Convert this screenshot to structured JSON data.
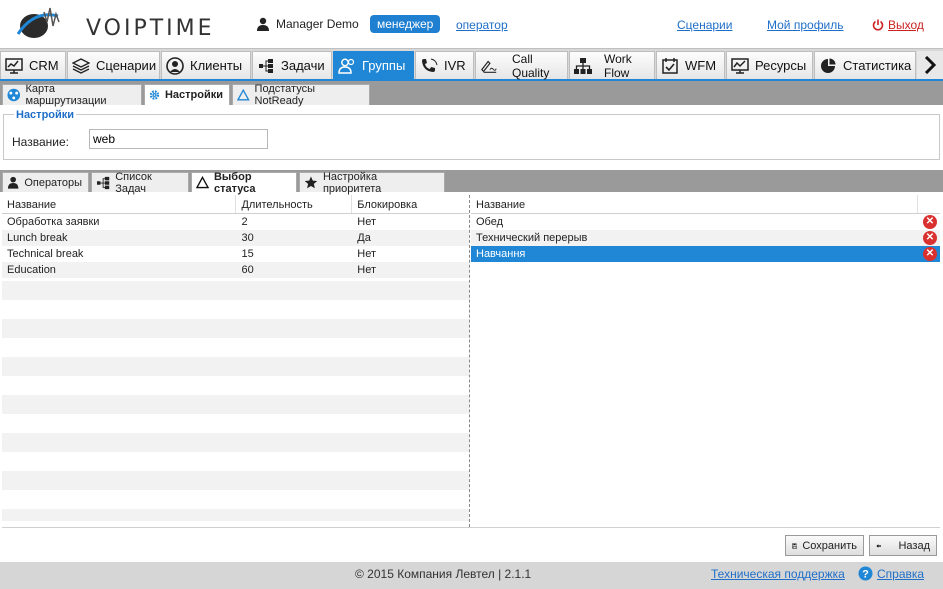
{
  "header": {
    "logo_text": "VOIPTIME",
    "user_name": "Manager Demo",
    "role_active": "менеджер",
    "role_other": "оператор",
    "links": [
      "Сценарии",
      "Мой профиль"
    ],
    "logout": "Выход"
  },
  "main_nav": {
    "tabs": [
      {
        "label": "CRM",
        "icon": "chart-icon"
      },
      {
        "label": "Сценарии",
        "icon": "layers-icon"
      },
      {
        "label": "Клиенты",
        "icon": "client-icon"
      },
      {
        "label": "Задачи",
        "icon": "tasks-icon"
      },
      {
        "label": "Группы",
        "icon": "group-icon",
        "active": true
      },
      {
        "label": "IVR",
        "icon": "ivr-icon"
      },
      {
        "label": "Call Quality",
        "icon": "signature-icon"
      },
      {
        "label": "Work Flow",
        "icon": "workflow-icon"
      },
      {
        "label": "WFM",
        "icon": "calendar-check-icon"
      },
      {
        "label": "Ресурсы",
        "icon": "resources-icon"
      },
      {
        "label": "Статистика",
        "icon": "pie-icon"
      }
    ]
  },
  "sub_nav": {
    "tabs": [
      {
        "label": "Карта маршрутизации",
        "icon": "routing-icon"
      },
      {
        "label": "Настройки",
        "icon": "gear-icon",
        "active": true
      },
      {
        "label": "Подстатусы NotReady",
        "icon": "triangle-icon"
      }
    ]
  },
  "settings": {
    "legend": "Настройки",
    "name_label": "Название:",
    "name_value": "web"
  },
  "inner_nav": {
    "tabs": [
      {
        "label": "Операторы",
        "icon": "user-icon"
      },
      {
        "label": "Список Задач",
        "icon": "tasks-icon"
      },
      {
        "label": "Выбор статуса",
        "icon": "triangle-icon",
        "active": true
      },
      {
        "label": "Настройка приоритета",
        "icon": "star-icon"
      }
    ]
  },
  "left_grid": {
    "columns": [
      "Название",
      "Длительность",
      "Блокировка"
    ],
    "rows": [
      [
        "Обработка заявки",
        "2",
        "Нет"
      ],
      [
        "Lunch break",
        "30",
        "Да"
      ],
      [
        "Technical break",
        "15",
        "Нет"
      ],
      [
        "Education",
        "60",
        "Нет"
      ]
    ]
  },
  "right_grid": {
    "columns": [
      "Название"
    ],
    "rows": [
      "Обед",
      "Технический перерыв",
      "Навчання"
    ],
    "selected_index": 2
  },
  "buttons": {
    "save": "Сохранить",
    "back": "Назад"
  },
  "footer": {
    "copyright": "© 2015 Компания Левтел | 2.1.1",
    "support": "Техническая поддержка",
    "help": "Справка"
  },
  "colors": {
    "accent": "#1f87d6",
    "danger": "#d93030"
  }
}
